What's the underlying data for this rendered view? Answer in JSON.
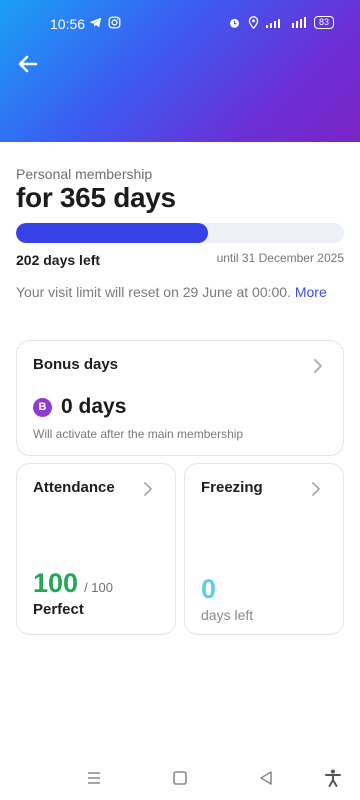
{
  "status_bar": {
    "time": "10:56",
    "battery": "83",
    "icons": [
      "telegram-icon",
      "instagram-icon",
      "alarm-icon",
      "location-icon",
      "signal-icon",
      "battery-icon"
    ]
  },
  "membership": {
    "label": "Personal membership",
    "title": "for 365 days",
    "progress_fraction": 0.585,
    "days_left": "202 days left",
    "until": "until 31 December 2025",
    "visit_limit_text": "Your visit limit will reset on 29 June at 00:00. ",
    "more_label": "More"
  },
  "bonus": {
    "title": "Bonus days",
    "badge": "B",
    "value": "0 days",
    "note": "Will activate after the main membership"
  },
  "attendance": {
    "title": "Attendance",
    "value": "100",
    "total": "/ 100",
    "status": "Perfect"
  },
  "freezing": {
    "title": "Freezing",
    "value": "0",
    "sub": "days left"
  },
  "colors": {
    "accent": "#3641e6",
    "attendance": "#26a65b",
    "freezing": "#5fcde8",
    "bonus_badge": "#8d3bd1"
  },
  "nav_icons": [
    "menu-icon",
    "home-square-icon",
    "back-triangle-icon",
    "accessibility-icon"
  ]
}
